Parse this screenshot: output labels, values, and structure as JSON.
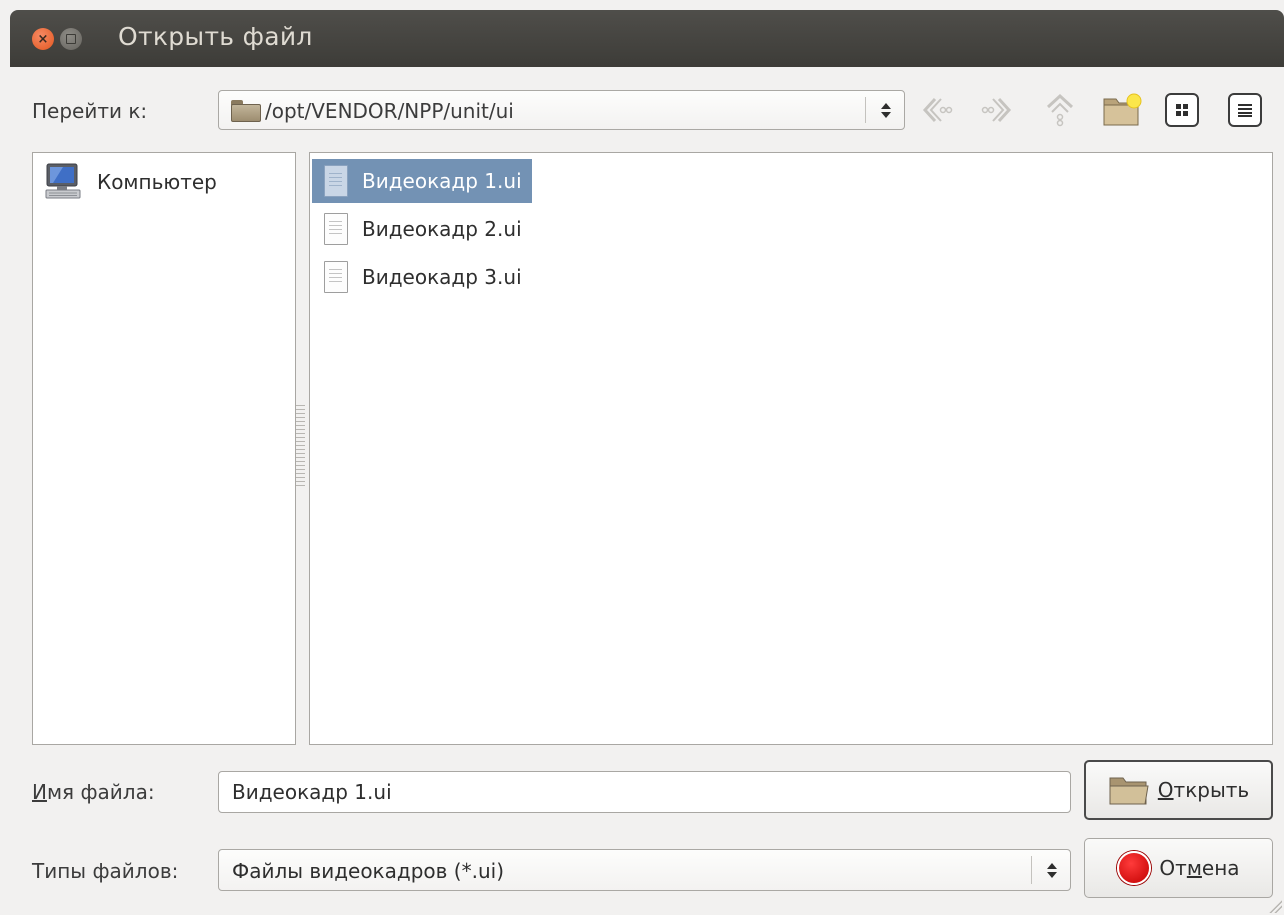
{
  "window": {
    "title": "Открыть файл"
  },
  "location": {
    "label": "Перейти к:",
    "path": "/opt/VENDOR/NPP/unit/ui"
  },
  "places": [
    {
      "label": "Компьютер",
      "icon": "computer-icon"
    }
  ],
  "files": [
    {
      "name": "Видеокадр 1.ui",
      "selected": true
    },
    {
      "name": "Видеокадр 2.ui",
      "selected": false
    },
    {
      "name": "Видеокадр 3.ui",
      "selected": false
    }
  ],
  "filename": {
    "label_underlined": "И",
    "label_rest": "мя файла:",
    "value": "Видеокадр 1.ui"
  },
  "filetype": {
    "label": "Типы файлов:",
    "value": "Файлы видеокадров (*.ui)"
  },
  "buttons": {
    "open_underlined": "О",
    "open_rest": "ткрыть",
    "cancel_pre": "От",
    "cancel_underlined": "м",
    "cancel_post": "ена"
  },
  "colors": {
    "selection": "#7392b4",
    "titlebar": "#3d3c38",
    "close": "#e2571f"
  }
}
